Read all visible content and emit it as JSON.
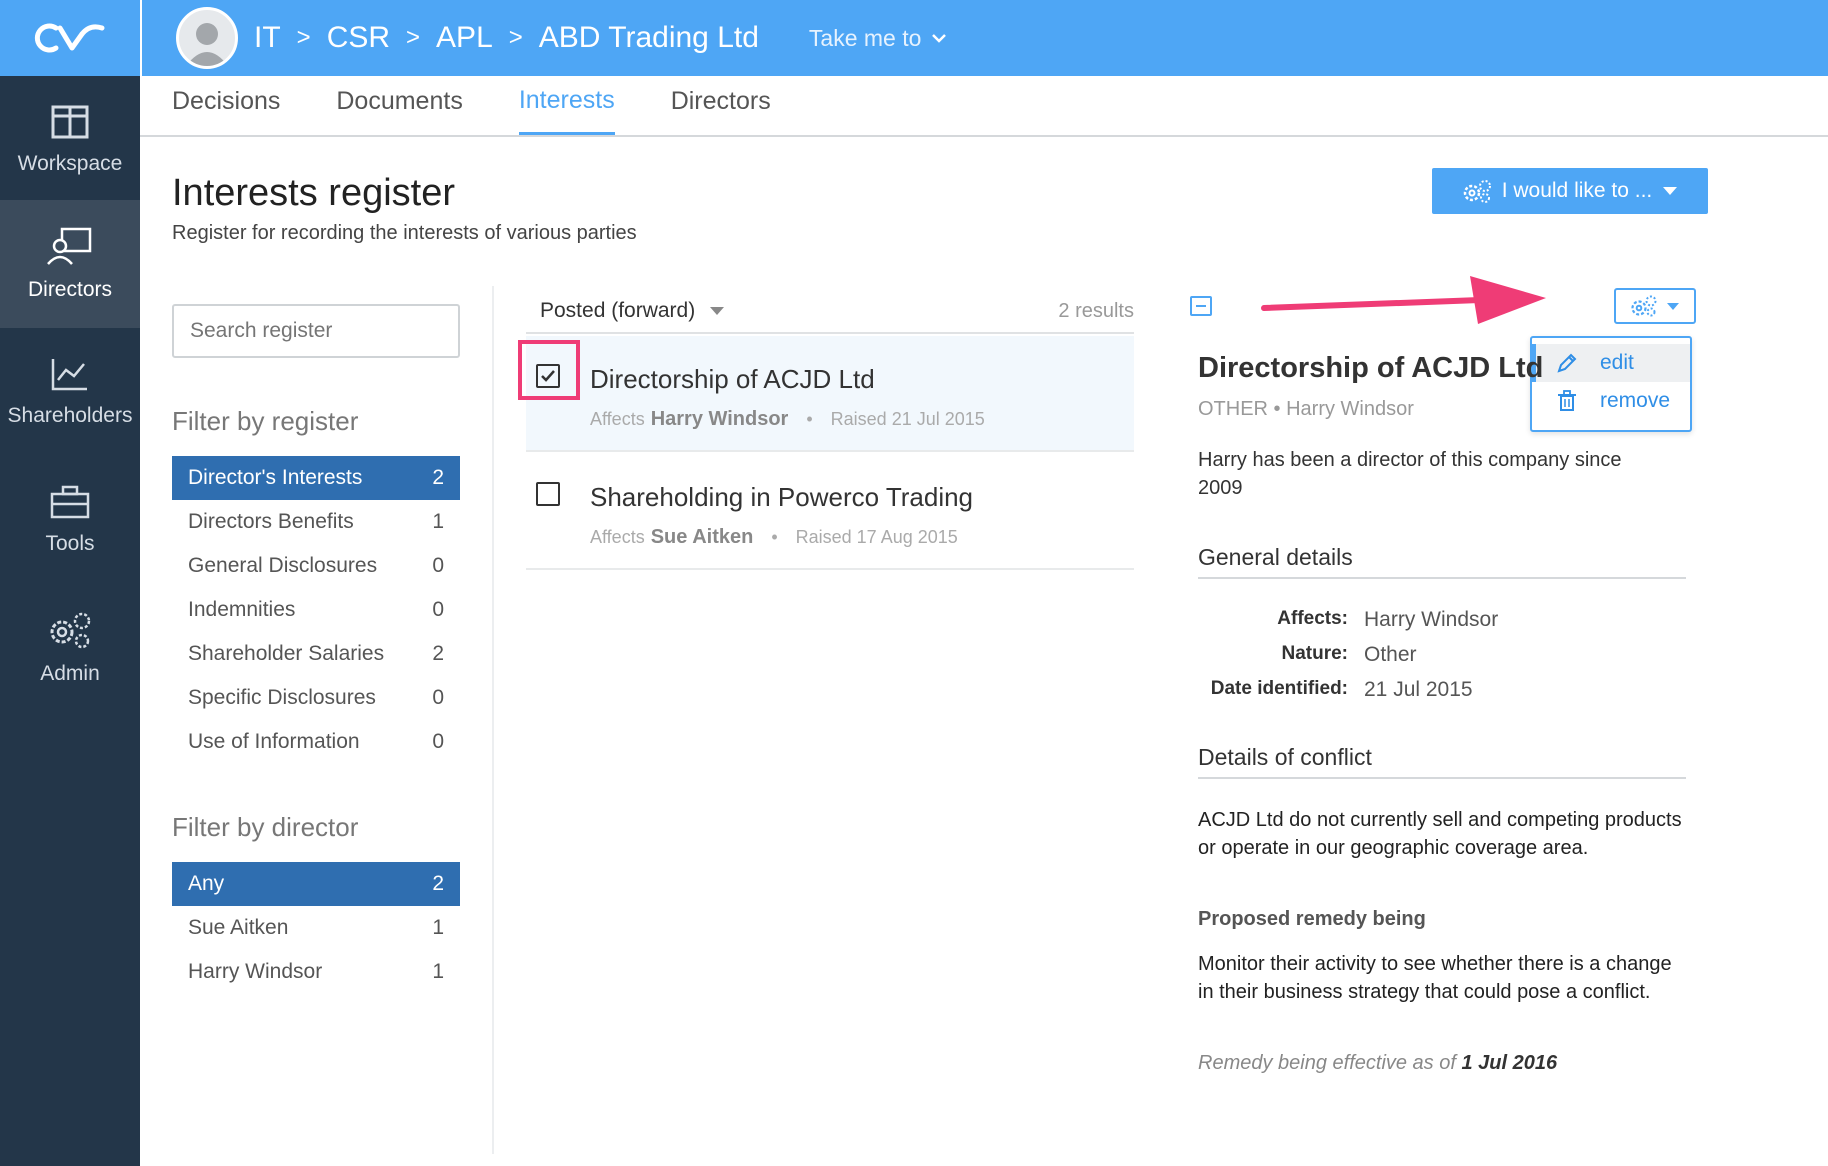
{
  "breadcrumb": [
    "IT",
    "CSR",
    "APL",
    "ABD Trading Ltd"
  ],
  "breadcrumb_sep": ">",
  "take_me_to": "Take me to",
  "sidebar": {
    "items": [
      {
        "label": "Workspace"
      },
      {
        "label": "Directors"
      },
      {
        "label": "Shareholders"
      },
      {
        "label": "Tools"
      },
      {
        "label": "Admin"
      }
    ]
  },
  "tabs": [
    {
      "label": "Decisions"
    },
    {
      "label": "Documents"
    },
    {
      "label": "Interests"
    },
    {
      "label": "Directors"
    }
  ],
  "page": {
    "title": "Interests register",
    "subtitle": "Register for recording the interests of various parties",
    "action_label": "I would like to ..."
  },
  "search": {
    "placeholder": "Search register"
  },
  "filter_register": {
    "heading": "Filter by register",
    "items": [
      {
        "label": "Director's Interests",
        "count": "2"
      },
      {
        "label": "Directors Benefits",
        "count": "1"
      },
      {
        "label": "General Disclosures",
        "count": "0"
      },
      {
        "label": "Indemnities",
        "count": "0"
      },
      {
        "label": "Shareholder Salaries",
        "count": "2"
      },
      {
        "label": "Specific Disclosures",
        "count": "0"
      },
      {
        "label": "Use of Information",
        "count": "0"
      }
    ]
  },
  "filter_director": {
    "heading": "Filter by director",
    "items": [
      {
        "label": "Any",
        "count": "2"
      },
      {
        "label": "Sue Aitken",
        "count": "1"
      },
      {
        "label": "Harry Windsor",
        "count": "1"
      }
    ]
  },
  "list": {
    "sort_label": "Posted (forward)",
    "results": "2 results",
    "items": [
      {
        "title": "Directorship of ACJD Ltd",
        "affects_label": "Affects",
        "affects": "Harry Windsor",
        "dot": "•",
        "raised": "Raised 21 Jul 2015",
        "checked": true
      },
      {
        "title": "Shareholding in Powerco Trading",
        "affects_label": "Affects",
        "affects": "Sue Aitken",
        "dot": "•",
        "raised": "Raised 17 Aug 2015",
        "checked": false
      }
    ]
  },
  "menu": {
    "edit": "edit",
    "remove": "remove"
  },
  "detail": {
    "title": "Directorship of ACJD Ltd",
    "meta": "OTHER • Harry Windsor",
    "description": "Harry has been a director of this company since 2009",
    "general_heading": "General details",
    "affects_key": "Affects:",
    "affects_val": "Harry Windsor",
    "nature_key": "Nature:",
    "nature_val": "Other",
    "date_key": "Date identified:",
    "date_val": "21 Jul 2015",
    "conflict_heading": "Details of conflict",
    "conflict_text": "ACJD Ltd do not currently sell and competing products or operate in our geographic coverage area.",
    "remedy_heading": "Proposed remedy being",
    "remedy_text": "Monitor their activity to see whether there is a change in their business strategy that could pose a conflict.",
    "effective_prefix": "Remedy being effective as of",
    "effective_date": "1 Jul 2016"
  },
  "colors": {
    "brand": "#4ea6f5",
    "sidebar": "#233649",
    "active_filter": "#2f6eb0",
    "highlight": "#ef3c76"
  }
}
